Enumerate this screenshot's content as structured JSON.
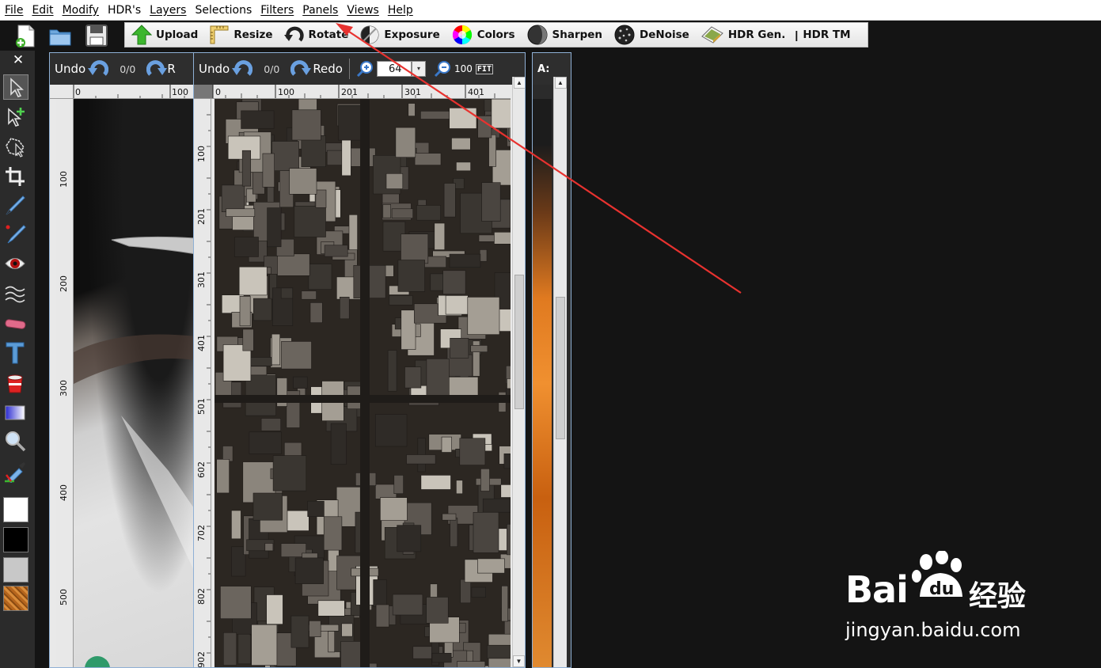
{
  "menu": [
    "File",
    "Edit",
    "Modify",
    "HDR's",
    "Layers",
    "Selections",
    "Filters",
    "Panels",
    "Views",
    "Help"
  ],
  "toolbar": {
    "upload": "Upload",
    "resize": "Resize",
    "rotate": "Rotate",
    "exposure": "Exposure",
    "colors": "Colors",
    "sharpen": "Sharpen",
    "denoise": "DeNoise",
    "hdr_gen": "HDR Gen.",
    "separator": "|",
    "hdr_tm": "HDR TM"
  },
  "palette": {
    "close": "✕"
  },
  "doc1": {
    "undo": "Undo",
    "history_count": "0/0",
    "redo_clipped": "R",
    "ruler_top": [
      "0",
      "100"
    ],
    "ruler_left": [
      "100",
      "200",
      "300",
      "400",
      "500"
    ]
  },
  "doc2": {
    "undo": "Undo",
    "history_count": "0/0",
    "redo": "Redo",
    "zoom_value": "64",
    "zoom_100": "100",
    "fit": "FIT",
    "ruler_top": [
      "0",
      "100",
      "201",
      "301",
      "401"
    ],
    "ruler_left": [
      "100",
      "201",
      "301",
      "401",
      "501",
      "602",
      "702",
      "802",
      "902"
    ]
  },
  "doc3": {
    "label": "A:"
  },
  "watermark": {
    "brand": "Bai",
    "brand2": "经验",
    "url": "jingyan.baidu.com"
  },
  "colors": {
    "annotation_arrow": "#e8322f",
    "window_border": "#8fb0d5",
    "background": "#141414"
  }
}
